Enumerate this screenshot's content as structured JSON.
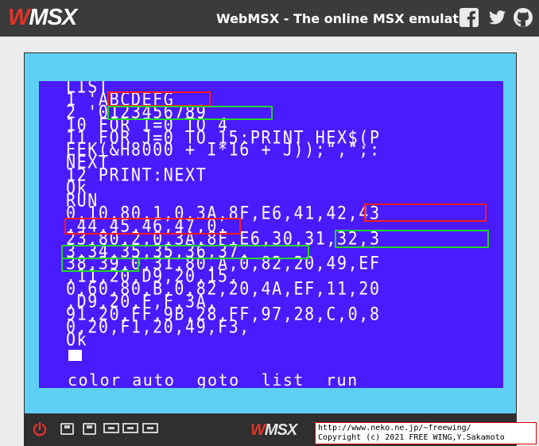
{
  "header": {
    "logo_text": "MSX",
    "title": "WebMSX - The online MSX emulator",
    "icons": [
      "facebook-icon",
      "twitter-icon",
      "github-icon"
    ]
  },
  "screen": {
    "lines": [
      "LIST",
      "1 'ABCDEFG",
      "2 '0123456789",
      "10 FOR I=0 TO 4",
      "11 FOR J=0 TO 15:PRINT HEX$(P",
      "EEK(&H8000 + I*16 + J));\",\";:",
      "NEXT",
      "12 PRINT:NEXT",
      "Ok",
      "RUN",
      "0,10,80,1,0,3A,8F,E6,41,42,43",
      ",44,45,46,47,0,",
      "23,80,2,0,3A,8F,E6,30,31,32,3",
      "3,34,35,35,36,37,",
      "38,39,0,31,80,A,0,82,20,49,EF",
      ",11,20,D9,20,15,",
      "0,60,80,B,0,82,20,4A,EF,11,20",
      ",D9,20,F,F,3A,",
      "91,20,FF,9B,28,FF,97,28,C,0,8",
      "0,20,F1,20,49,F3,",
      "Ok"
    ],
    "function_keys": "color auto  goto  list  run"
  },
  "toolbar": {
    "logo_text": "MSX",
    "icons": [
      "power-icon",
      "disk-a-icon",
      "disk-b-icon",
      "cartridge-1-icon",
      "cartridge-2-icon",
      "tape-icon"
    ]
  },
  "copyright": {
    "url": "http://www.neko.ne.jp/~freewing/",
    "text": "Copyright (c) 2021 FREE WING,Y.Sakamoto"
  },
  "colors": {
    "header_bg": "#3b3b3b",
    "frame_bg": "#5fd0f5",
    "screen_bg": "#4a1bff",
    "highlight_red": "#ff1a1a",
    "highlight_green": "#21d52a"
  }
}
